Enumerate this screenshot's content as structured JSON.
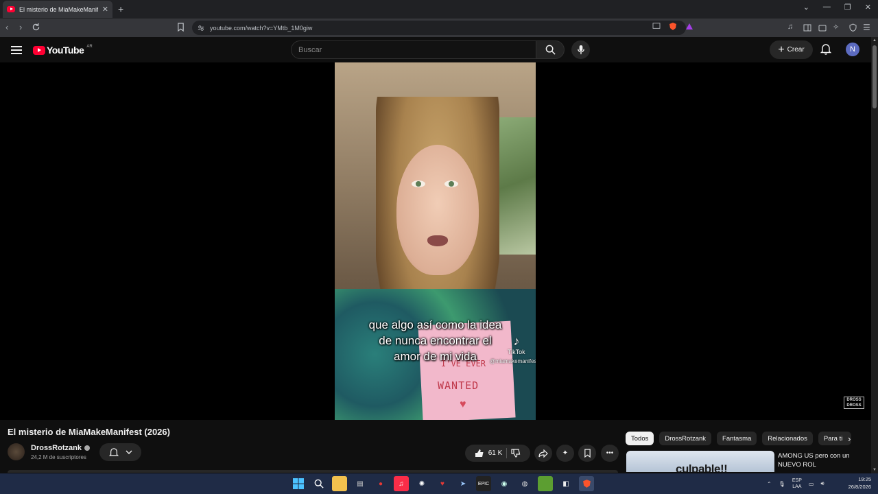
{
  "browser": {
    "tab_title": "El misterio de MiaMakeManifest",
    "url": "youtube.com/watch?v=YMtb_1M0giw"
  },
  "masthead": {
    "logo_text": "YouTube",
    "country_code": "AR",
    "search_placeholder": "Buscar",
    "create_label": "Crear",
    "avatar_initial": "N"
  },
  "video": {
    "subtitle_lines": [
      "que algo así como la idea",
      "de nunca encontrar el",
      "amor de mi vida"
    ],
    "tiktok_label": "TikTok",
    "tiktok_handle": "@miamakemanifest",
    "card_text": "WANTED",
    "card_text_top": "I'VE EVER",
    "watermark": "DROSS DROSS"
  },
  "watch": {
    "title": "El misterio de MiaMakeManifest (2026)",
    "channel_name": "DrossRotzank",
    "subscribers": "24,2 M de suscriptores",
    "likes": "61 K"
  },
  "chips": [
    "Todos",
    "DrossRotzank",
    "Fantasma",
    "Relacionados",
    "Para ti"
  ],
  "recommendation": {
    "title": "AMONG US pero con un NUEVO ROL",
    "thumb_text": "culpable!!"
  },
  "taskbar": {
    "lang_top": "ESP",
    "lang_bottom": "LAA",
    "time": "19:25",
    "date": "26/8/2026"
  },
  "colors": {
    "youtube_red": "#ff0033",
    "background": "#0f0f0f",
    "taskbar": "#1f2b46"
  }
}
